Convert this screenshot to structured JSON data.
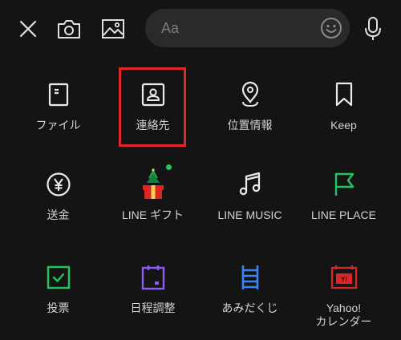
{
  "input": {
    "placeholder": "Aa"
  },
  "menu": [
    {
      "icon": "file-icon",
      "label": "ファイル"
    },
    {
      "icon": "contact-icon",
      "label": "連絡先"
    },
    {
      "icon": "location-pin-icon",
      "label": "位置情報"
    },
    {
      "icon": "bookmark-icon",
      "label": "Keep"
    },
    {
      "icon": "yen-icon",
      "label": "送金"
    },
    {
      "icon": "gift-icon",
      "label": "LINE ギフト"
    },
    {
      "icon": "music-note-icon",
      "label": "LINE MUSIC"
    },
    {
      "icon": "flag-icon",
      "label": "LINE PLACE"
    },
    {
      "icon": "vote-icon",
      "label": "投票"
    },
    {
      "icon": "calendar-icon",
      "label": "日程調整"
    },
    {
      "icon": "ladder-icon",
      "label": "あみだくじ"
    },
    {
      "icon": "yahoo-calendar-icon",
      "label": "Yahoo!\nカレンダー"
    }
  ],
  "colors": {
    "background": "#141414",
    "highlight": "#e3262a",
    "green": "#22c55e",
    "purple": "#8b5cf6",
    "blue": "#3b82f6",
    "red": "#dc2626"
  }
}
